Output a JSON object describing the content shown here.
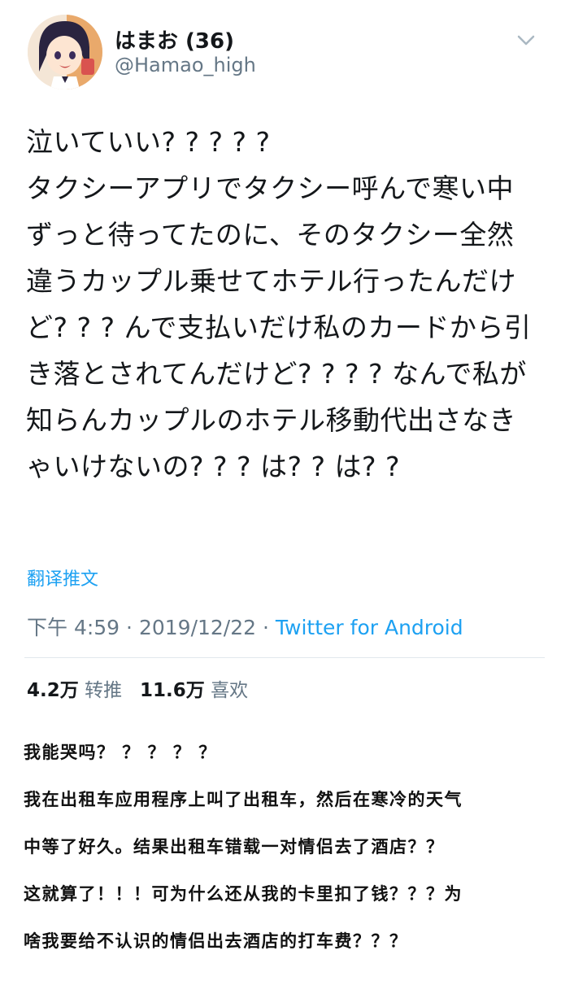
{
  "tweet": {
    "author": {
      "display_name": "はまお (36)",
      "handle": "@Hamao_high",
      "avatar_icon": "anime-avatar"
    },
    "menu_icon": "chevron-down-icon",
    "text": "泣いていい? ? ? ? ?\nタクシーアプリでタクシー呼んで寒い中ずっと待ってたのに、そのタクシー全然違うカップル乗せてホテル行ったんだけど? ? ? んで支払いだけ私のカードから引き落とされてんだけど? ? ? ? なんで私が知らんカップルのホテル移動代出さなきゃいけないの? ? ? は? ? は? ?",
    "translate_label": "翻译推文",
    "time": "下午 4:59",
    "date": "2019/12/22",
    "separator": "·",
    "source": "Twitter for Android",
    "retweets": {
      "count": "4.2万",
      "label": "转推"
    },
    "likes": {
      "count": "11.6万",
      "label": "喜欢"
    }
  },
  "translation": {
    "lines": [
      "我能哭吗？ ？ ？ ？ ？",
      "我在出租车应用程序上叫了出租车，然后在寒冷的天气",
      "中等了好久。结果出租车错载一对情侣去了酒店？？",
      "这就算了！！！可为什么还从我的卡里扣了钱？？？为",
      "啥我要给不认识的情侣出去酒店的打车费？？？"
    ]
  },
  "colors": {
    "link": "#1da1f2",
    "secondary_text": "#657786",
    "primary_text": "#14171a",
    "divider": "#e1e8ed"
  }
}
